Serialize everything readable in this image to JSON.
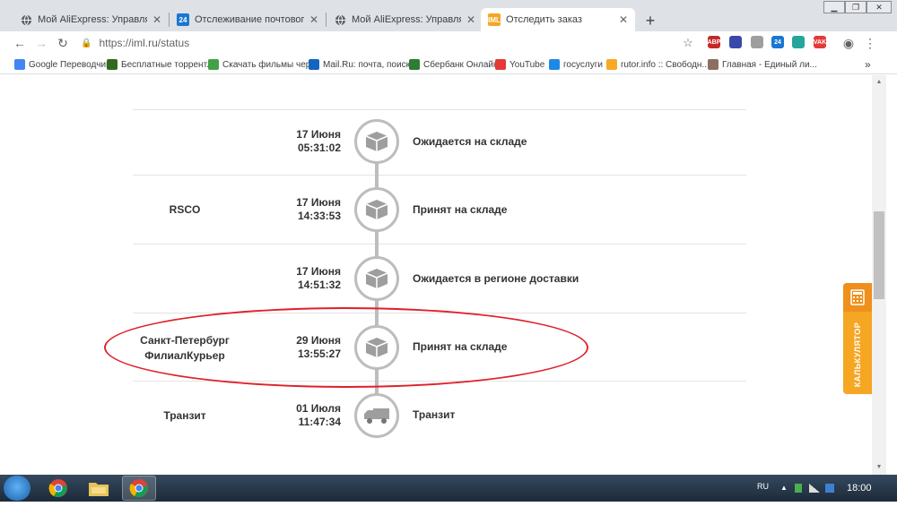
{
  "browser": {
    "tabs": [
      {
        "title": "Мой AliExpress: Управлять заказа",
        "favicon": "globe-icon"
      },
      {
        "title": "Отслеживание почтового отправ",
        "favicon": "site-24-icon"
      },
      {
        "title": "Мой AliExpress: Управлять заказа",
        "favicon": "globe-icon"
      },
      {
        "title": "Отследить заказ",
        "favicon": "iml-icon",
        "favicon_text": "IML"
      }
    ],
    "new_tab_label": "+",
    "url": "https://iml.ru/status",
    "extensions": [
      {
        "name": "adblock-icon",
        "text": "ABP",
        "color": "#c62828"
      },
      {
        "name": "block-icon",
        "text": "",
        "color": "#3949ab"
      },
      {
        "name": "puzzle-icon",
        "text": "",
        "color": "#9e9e9e"
      },
      {
        "name": "counter-24-icon",
        "text": "24",
        "color": "#1976d2"
      },
      {
        "name": "shield-green-icon",
        "text": "",
        "color": "#26a69a"
      },
      {
        "name": "vak-icon",
        "text": "VAK",
        "color": "#e53935"
      }
    ],
    "bookmarks": [
      {
        "label": "Google Переводчик",
        "color": "#4285f4"
      },
      {
        "label": "Бесплатные торрент...",
        "color": "#33691e"
      },
      {
        "label": "Скачать фильмы чер...",
        "color": "#43a047"
      },
      {
        "label": "Mail.Ru: почта, поиск...",
        "color": "#1565c0"
      },
      {
        "label": "Сбербанк Онлайн",
        "color": "#2e7d32"
      },
      {
        "label": "YouTube",
        "color": "#e53935"
      },
      {
        "label": "госуслуги",
        "color": "#1e88e5"
      },
      {
        "label": "rutor.info :: Свободн...",
        "color": "#f9a825"
      },
      {
        "label": "Главная - Единый ли...",
        "color": "#8d6e63"
      }
    ],
    "bookmarks_more": "»"
  },
  "tracking": {
    "events": [
      {
        "place": "",
        "date": "17 Июня",
        "time": "05:31:02",
        "status": "Ожидается на складе",
        "icon": "box-icon"
      },
      {
        "place": "RSCO",
        "date": "17 Июня",
        "time": "14:33:53",
        "status": "Принят на складе",
        "icon": "box-icon"
      },
      {
        "place": "",
        "date": "17 Июня",
        "time": "14:51:32",
        "status": "Ожидается в регионе доставки",
        "icon": "box-icon"
      },
      {
        "place": "Санкт-Петербург ФилиалКурьер",
        "date": "29 Июня",
        "time": "13:55:27",
        "status": "Принят на складе",
        "icon": "box-icon"
      },
      {
        "place": "Транзит",
        "date": "01 Июля",
        "time": "11:47:34",
        "status": "Транзит",
        "icon": "truck-icon"
      }
    ],
    "highlight_color": "#e0202a"
  },
  "calculator": {
    "label": "КАЛЬКУЛЯТОР",
    "color": "#f5a623"
  },
  "taskbar": {
    "lang": "RU",
    "clock": "18:00"
  }
}
